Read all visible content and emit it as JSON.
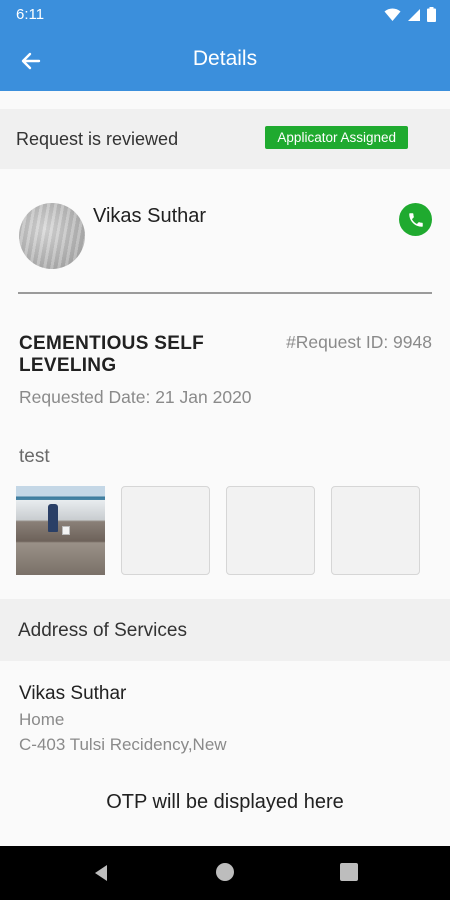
{
  "status_bar": {
    "time": "6:11"
  },
  "app_bar": {
    "title": "Details"
  },
  "request_status": {
    "text": "Request is reviewed",
    "badge": "Applicator Assigned"
  },
  "applicator": {
    "name": "Vikas Suthar"
  },
  "service": {
    "title": "CEMENTIOUS SELF LEVELING",
    "request_id": "#Request ID: 9948",
    "requested_date": "Requested Date: 21 Jan 2020",
    "description": "test"
  },
  "photos": [
    {
      "state": "filled"
    },
    {
      "state": "empty"
    },
    {
      "state": "empty"
    },
    {
      "state": "empty"
    }
  ],
  "address": {
    "header": "Address of Services",
    "name": "Vikas Suthar",
    "type": "Home",
    "line": "C-403 Tulsi Recidency,New"
  },
  "otp": {
    "text": "OTP will be displayed here"
  },
  "colors": {
    "primary": "#3b8fdc",
    "success": "#1faa2f",
    "background": "#fafafa"
  },
  "icons": {
    "back": "arrow-left-icon",
    "call": "phone-icon",
    "wifi": "wifi-icon",
    "signal": "signal-icon",
    "battery": "battery-icon"
  }
}
